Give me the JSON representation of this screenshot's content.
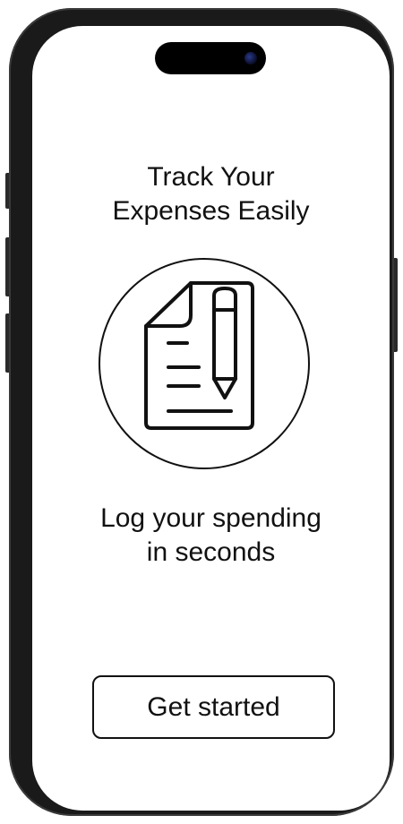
{
  "onboarding": {
    "headline": "Track Your\nExpenses Easily",
    "subline": "Log your spending\nin seconds",
    "illustration_icon": "document-with-pencil-icon",
    "cta_label": "Get started"
  },
  "colors": {
    "ink": "#111111",
    "background": "#ffffff",
    "phone_frame": "#1a1a1a"
  }
}
